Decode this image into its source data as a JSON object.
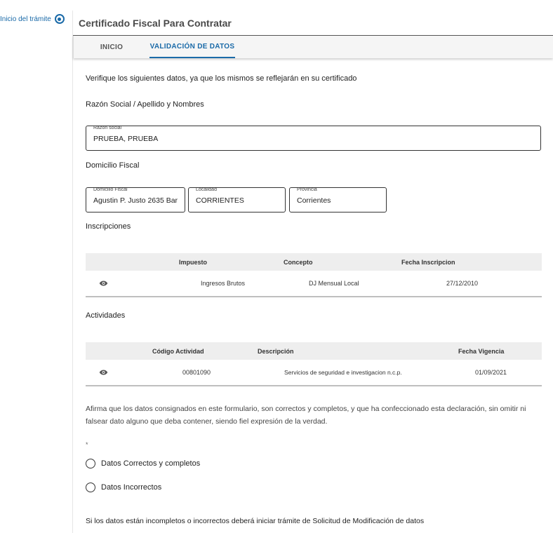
{
  "stepper": {
    "label": "Inicio del trámite"
  },
  "header": {
    "title": "Certificado Fiscal Para Contratar"
  },
  "tabs": [
    {
      "label": "INICIO",
      "active": false
    },
    {
      "label": "VALIDACIÓN DE DATOS",
      "active": true
    }
  ],
  "intro": "Verifique los siguientes datos, ya que los mismos se reflejarán en su certificado",
  "razon_section": {
    "title": "Razón Social / Apellido y Nombres",
    "field_legend": "Razón social",
    "field_value": "PRUEBA, PRUEBA"
  },
  "domicilio_section": {
    "title": "Domicilio Fiscal",
    "fields": [
      {
        "legend": "Domicilio Fiscal",
        "value": "Agustin P. Justo 2635 Bar"
      },
      {
        "legend": "Localidad",
        "value": "CORRIENTES"
      },
      {
        "legend": "Provincia",
        "value": "Corrientes"
      }
    ]
  },
  "inscripciones": {
    "title": "Inscripciones",
    "columns": [
      "Impuesto",
      "Concepto",
      "Fecha Inscripcion"
    ],
    "rows": [
      {
        "impuesto": "Ingresos Brutos",
        "concepto": "DJ Mensual Local",
        "fecha": "27/12/2010"
      }
    ]
  },
  "actividades": {
    "title": "Actividades",
    "columns": [
      "Código Actividad",
      "Descripción",
      "Fecha Vigencia"
    ],
    "rows": [
      {
        "codigo": "00801090",
        "descripcion": "Servicios de seguridad e investigacion n.c.p.",
        "fecha": "01/09/2021"
      }
    ]
  },
  "declaracion": {
    "line1": "Afirma que los datos consignados en este formulario, son correctos y completos, y que ha confeccionado esta declaración, sin omitir ni",
    "line2": "falsear dato alguno que deba contener, siendo fiel expresión de la verdad.",
    "required_mark": "*",
    "options": [
      "Datos Correctos y completos",
      "Datos Incorrectos"
    ]
  },
  "footer_note": "Si los datos están incompletos o incorrectos deberá iniciar trámite de Solicitud de Modificación de datos",
  "colors": {
    "accent": "#1a6aa8",
    "table_header_bg": "#eeeeee"
  }
}
